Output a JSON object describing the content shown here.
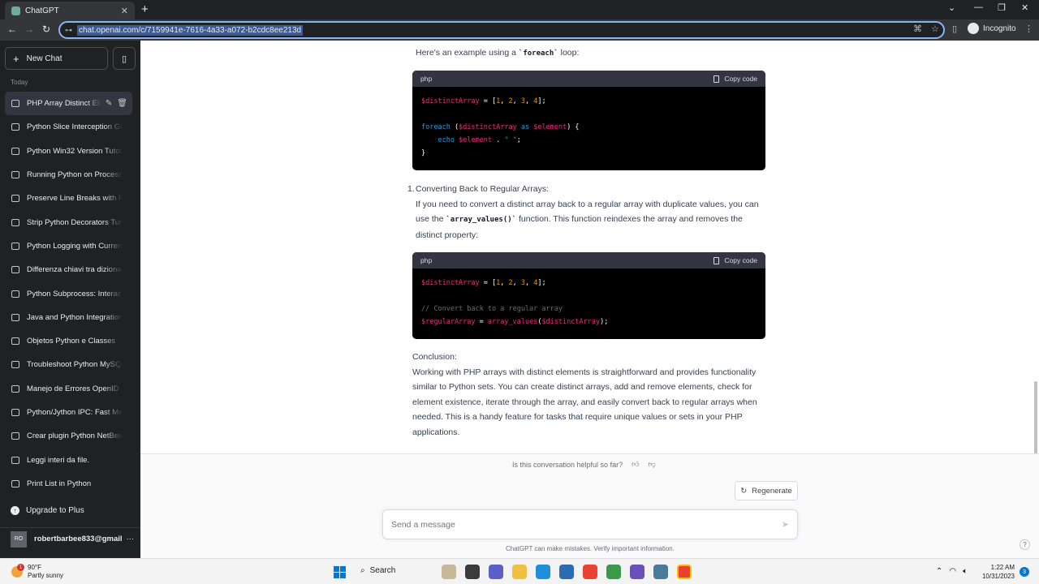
{
  "browser": {
    "tab_title": "ChatGPT",
    "url": "chat.openai.com/c/7159941e-7616-4a33-a072-b2cdc8ee213d",
    "incognito_label": "Incognito"
  },
  "sidebar": {
    "new_chat_label": "New Chat",
    "section_label": "Today",
    "conversations": [
      "PHP Array Distinct Ele",
      "Python Slice Interception Gu",
      "Python Win32 Version Tutori",
      "Running Python on Processo",
      "Preserve Line Breaks with Py",
      "Strip Python Decorators Tuto",
      "Python Logging with Current",
      "Differenza chiavi tra dizionari",
      "Python Subprocess: Interact",
      "Java and Python Integration",
      "Objetos Python e Classes",
      "Troubleshoot Python MySQL",
      "Manejo de Errores OpenID",
      "Python/Jython IPC: Fast Meth",
      "Crear plugin Python NetBean",
      "Leggi interi da file.",
      "Print List in Python"
    ],
    "upgrade_label": "Upgrade to Plus",
    "account_initials": "RO",
    "account_email": "robertbarbee833@gmail"
  },
  "chat": {
    "intro_before": "Here's an example using a ",
    "intro_code": "`foreach`",
    "intro_after": " loop:",
    "code_lang": "php",
    "copy_label": "Copy code",
    "list_number": "1.",
    "list_heading": "Converting Back to Regular Arrays:",
    "list_body_before": "If you need to convert a distinct array back to a regular array with duplicate values, you can use the ",
    "list_body_code": "`array_values()`",
    "list_body_after": " function. This function reindexes the array and removes the distinct property:",
    "conclusion_heading": "Conclusion:",
    "conclusion_body": "Working with PHP arrays with distinct elements is straightforward and provides functionality similar to Python sets. You can create distinct arrays, add and remove elements, check for element existence, iterate through the array, and easily convert back to regular arrays when needed. This is a handy feature for tasks that require unique values or sets in your PHP applications."
  },
  "footer": {
    "helpful_question": "Is this conversation helpful so far?",
    "regenerate_label": "Regenerate",
    "composer_placeholder": "Send a message",
    "disclaimer": "ChatGPT can make mistakes. Verify important information.",
    "help_label": "?"
  },
  "taskbar": {
    "temperature": "90°F",
    "weather_desc": "Partly sunny",
    "weather_badge": "1",
    "search_label": "Search",
    "time": "1:22 AM",
    "date": "10/31/2023",
    "notification_count": "3"
  },
  "colors": {
    "sidebar_bg": "#202123",
    "code_bg": "#000000",
    "omnibox_focus": "#8ab4f8",
    "windows_blue": "#0078d4"
  }
}
